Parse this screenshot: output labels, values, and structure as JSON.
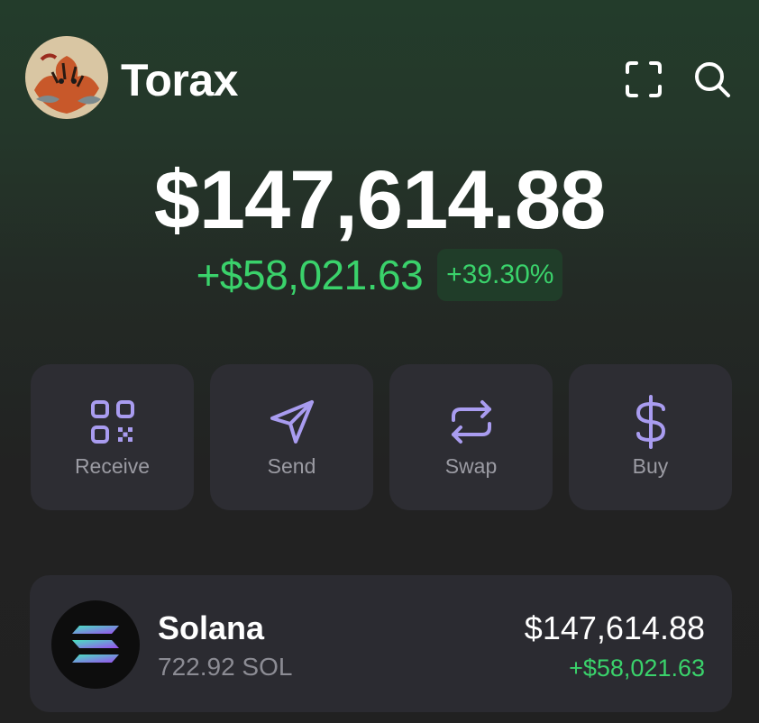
{
  "header": {
    "wallet_name": "Torax",
    "avatar": "tiger-avatar",
    "scan_icon": "scan-icon",
    "search_icon": "search-icon"
  },
  "portfolio": {
    "balance": "$147,614.88",
    "change_amount": "+$58,021.63",
    "change_percent": "+39.30%"
  },
  "actions": [
    {
      "label": "Receive",
      "icon": "qr-code-icon"
    },
    {
      "label": "Send",
      "icon": "send-icon"
    },
    {
      "label": "Swap",
      "icon": "swap-icon"
    },
    {
      "label": "Buy",
      "icon": "dollar-icon"
    }
  ],
  "tokens": [
    {
      "name": "Solana",
      "amount": "722.92 SOL",
      "value": "$147,614.88",
      "change": "+$58,021.63",
      "icon": "solana-icon"
    }
  ],
  "colors": {
    "positive": "#3ad26b",
    "accent": "#a99cf0",
    "card": "#2d2d33"
  }
}
